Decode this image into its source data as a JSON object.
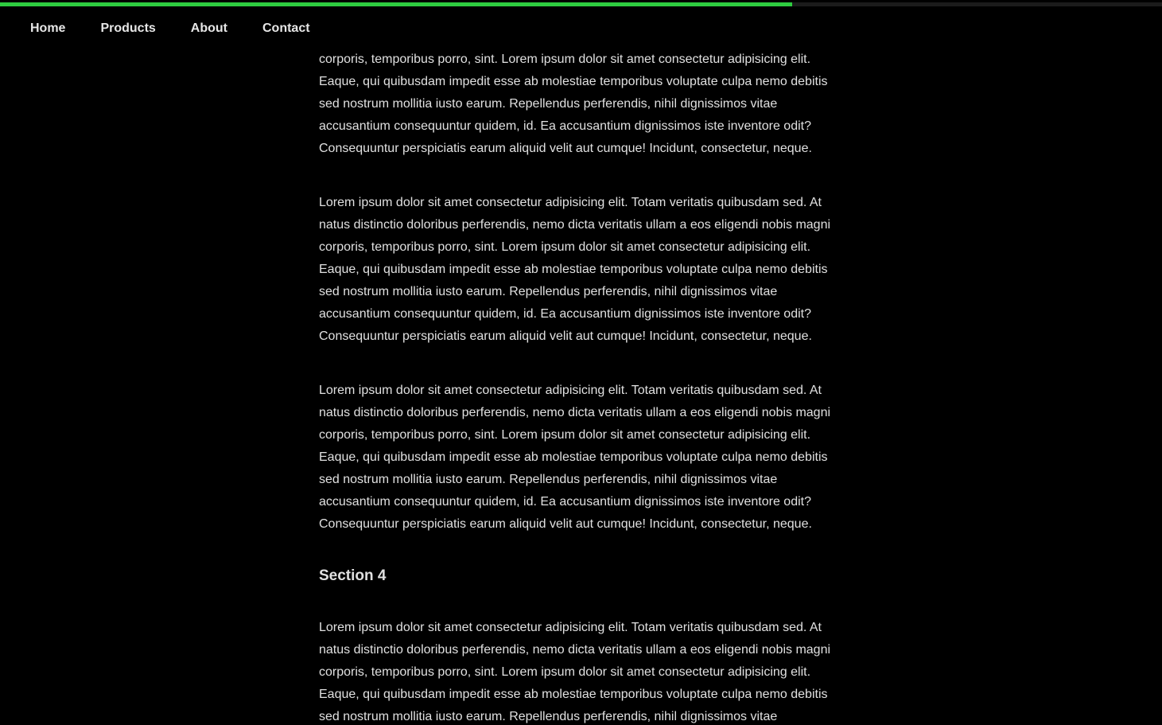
{
  "progress": {
    "percent": 68.2,
    "track_color": "#1b1b1b",
    "fill_color": "#2ecc40"
  },
  "nav": {
    "items": [
      {
        "label": "Home"
      },
      {
        "label": "Products"
      },
      {
        "label": "About"
      },
      {
        "label": "Contact"
      }
    ]
  },
  "content": {
    "partial_paragraph_top": {
      "lines": [
        "corporis, temporibus porro, sint. Lorem ipsum dolor sit amet consectetur adipisicing elit.",
        "Eaque, qui quibusdam impedit esse ab molestiae temporibus voluptate culpa nemo debitis",
        "sed nostrum mollitia iusto earum. Repellendus perferendis, nihil dignissimos vitae",
        "accusantium consequuntur quidem, id. Ea accusantium dignissimos iste inventore odit?",
        "Consequuntur perspiciatis earum aliquid velit aut cumque! Incidunt, consectetur, neque."
      ]
    },
    "paragraph_2": {
      "lines": [
        "Lorem ipsum dolor sit amet consectetur adipisicing elit. Totam veritatis quibusdam sed. At",
        "natus distinctio doloribus perferendis, nemo dicta veritatis ullam a eos eligendi nobis magni",
        "corporis, temporibus porro, sint. Lorem ipsum dolor sit amet consectetur adipisicing elit.",
        "Eaque, qui quibusdam impedit esse ab molestiae temporibus voluptate culpa nemo debitis",
        "sed nostrum mollitia iusto earum. Repellendus perferendis, nihil dignissimos vitae",
        "accusantium consequuntur quidem, id. Ea accusantium dignissimos iste inventore odit?",
        "Consequuntur perspiciatis earum aliquid velit aut cumque! Incidunt, consectetur, neque."
      ]
    },
    "paragraph_3": {
      "lines": [
        "Lorem ipsum dolor sit amet consectetur adipisicing elit. Totam veritatis quibusdam sed. At",
        "natus distinctio doloribus perferendis, nemo dicta veritatis ullam a eos eligendi nobis magni",
        "corporis, temporibus porro, sint. Lorem ipsum dolor sit amet consectetur adipisicing elit.",
        "Eaque, qui quibusdam impedit esse ab molestiae temporibus voluptate culpa nemo debitis",
        "sed nostrum mollitia iusto earum. Repellendus perferendis, nihil dignissimos vitae",
        "accusantium consequuntur quidem, id. Ea accusantium dignissimos iste inventore odit?",
        "Consequuntur perspiciatis earum aliquid velit aut cumque! Incidunt, consectetur, neque."
      ]
    },
    "section_heading": "Section 4",
    "paragraph_4": {
      "lines": [
        "Lorem ipsum dolor sit amet consectetur adipisicing elit. Totam veritatis quibusdam sed. At",
        "natus distinctio doloribus perferendis, nemo dicta veritatis ullam a eos eligendi nobis magni",
        "corporis, temporibus porro, sint. Lorem ipsum dolor sit amet consectetur adipisicing elit.",
        "Eaque, qui quibusdam impedit esse ab molestiae temporibus voluptate culpa nemo debitis",
        "sed nostrum mollitia iusto earum. Repellendus perferendis, nihil dignissimos vitae"
      ]
    }
  }
}
